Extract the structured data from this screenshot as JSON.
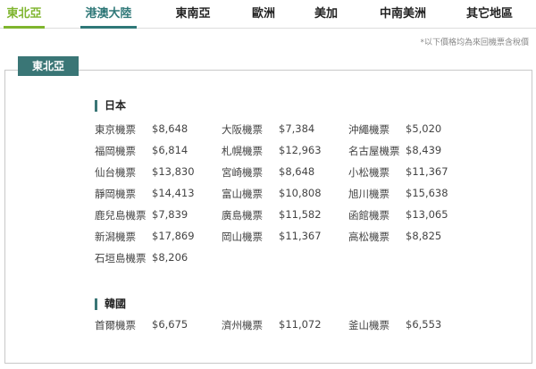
{
  "tabs": [
    {
      "label": "東北亞"
    },
    {
      "label": "港澳大陸"
    },
    {
      "label": "東南亞"
    },
    {
      "label": "歐洲"
    },
    {
      "label": "美加"
    },
    {
      "label": "中南美洲"
    },
    {
      "label": "其它地區"
    }
  ],
  "note": "*以下價格均為來回機票含稅價",
  "section_label": "東北亞",
  "countries": [
    {
      "name": "日本",
      "items": [
        {
          "city": "東京機票",
          "price": "$8,648"
        },
        {
          "city": "大阪機票",
          "price": "$7,384"
        },
        {
          "city": "沖繩機票",
          "price": "$5,020"
        },
        {
          "city": "福岡機票",
          "price": "$6,814"
        },
        {
          "city": "札幌機票",
          "price": "$12,963"
        },
        {
          "city": "名古屋機票",
          "price": "$8,439"
        },
        {
          "city": "仙台機票",
          "price": "$13,830"
        },
        {
          "city": "宮崎機票",
          "price": "$8,648"
        },
        {
          "city": "小松機票",
          "price": "$11,367"
        },
        {
          "city": "靜岡機票",
          "price": "$14,413"
        },
        {
          "city": "富山機票",
          "price": "$10,808"
        },
        {
          "city": "旭川機票",
          "price": "$15,638"
        },
        {
          "city": "鹿兒島機票",
          "price": "$7,839"
        },
        {
          "city": "廣島機票",
          "price": "$11,582"
        },
        {
          "city": "函館機票",
          "price": "$13,065"
        },
        {
          "city": "新潟機票",
          "price": "$17,869"
        },
        {
          "city": "岡山機票",
          "price": "$11,367"
        },
        {
          "city": "高松機票",
          "price": "$8,825"
        },
        {
          "city": "石垣島機票",
          "price": "$8,206"
        }
      ]
    },
    {
      "name": "韓國",
      "items": [
        {
          "city": "首爾機票",
          "price": "$6,675"
        },
        {
          "city": "濟州機票",
          "price": "$11,072"
        },
        {
          "city": "釜山機票",
          "price": "$6,553"
        }
      ]
    }
  ]
}
